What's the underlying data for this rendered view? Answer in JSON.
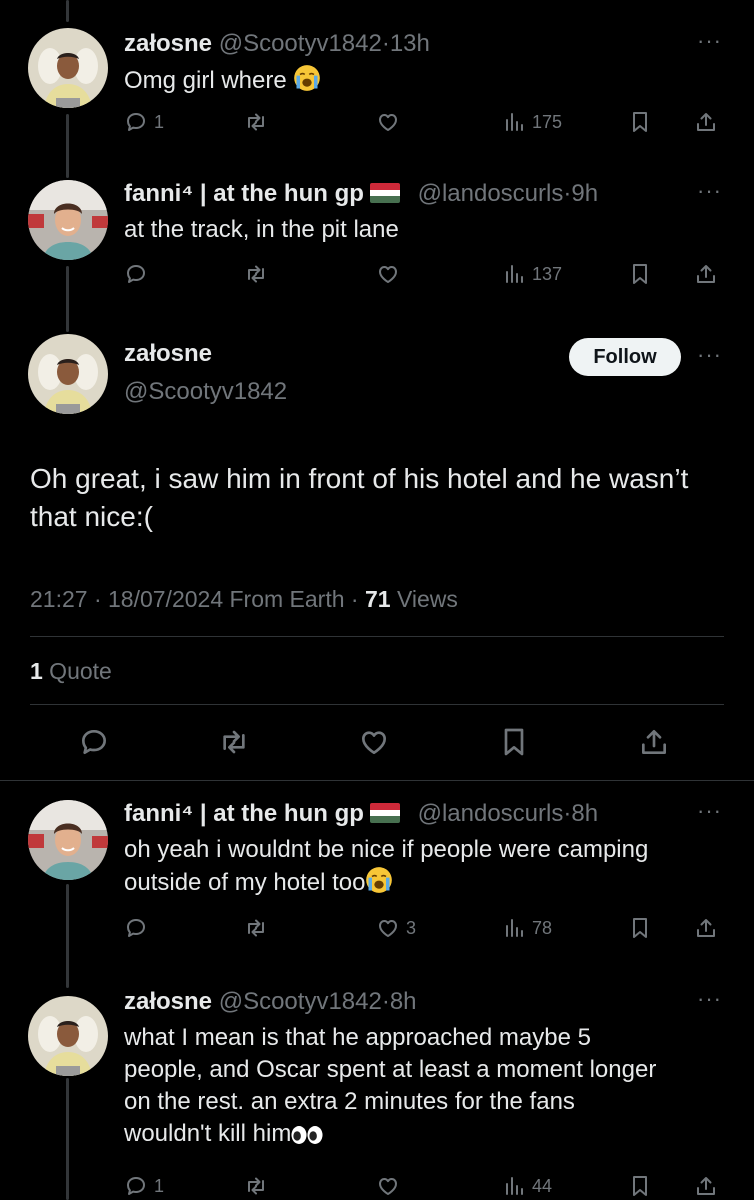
{
  "tweets": [
    {
      "name": "załosne",
      "handle": "@Scootyv1842",
      "time": "13h",
      "text": "Omg girl where",
      "emoji": "crying-face",
      "replies": "1",
      "likes": "",
      "views": "175"
    },
    {
      "name": "fanni⁴ | at the hun gp",
      "flag": "hungary-flag",
      "handle": "@landoscurls",
      "time": "9h",
      "text": "at the track, in the pit lane",
      "replies": "",
      "likes": "",
      "views": "137"
    },
    {
      "name": "fanni⁴ | at the hun gp",
      "flag": "hungary-flag",
      "handle": "@landoscurls",
      "time": "8h",
      "text": "oh yeah i wouldnt be nice if people were camping outside of my hotel too",
      "emoji": "crying-face",
      "replies": "",
      "likes": "3",
      "views": "78"
    },
    {
      "name": "załosne",
      "handle": "@Scootyv1842",
      "time": "8h",
      "text": "what I mean is that he approached maybe 5 people, and Oscar spent at least a moment longer on the rest. an extra 2 minutes for the fans wouldn't kill him",
      "emoji": "eyes",
      "replies": "1",
      "likes": "",
      "views": "44"
    }
  ],
  "focus": {
    "name": "załosne",
    "handle": "@Scootyv1842",
    "follow_label": "Follow",
    "text": "Oh great, i saw him in front of his hotel and he wasn’t that nice:(",
    "meta_prefix": "21:27 · 18/07/2024 From Earth · ",
    "views_count": "71",
    "views_label": " Views",
    "quote_count": "1",
    "quote_label": " Quote"
  },
  "dot": "·",
  "more": "···",
  "colors": {
    "background": "#000000",
    "text": "#e7e9ea",
    "muted": "#71767b",
    "divider": "#2f3336",
    "follow_bg": "#eff3f4"
  }
}
